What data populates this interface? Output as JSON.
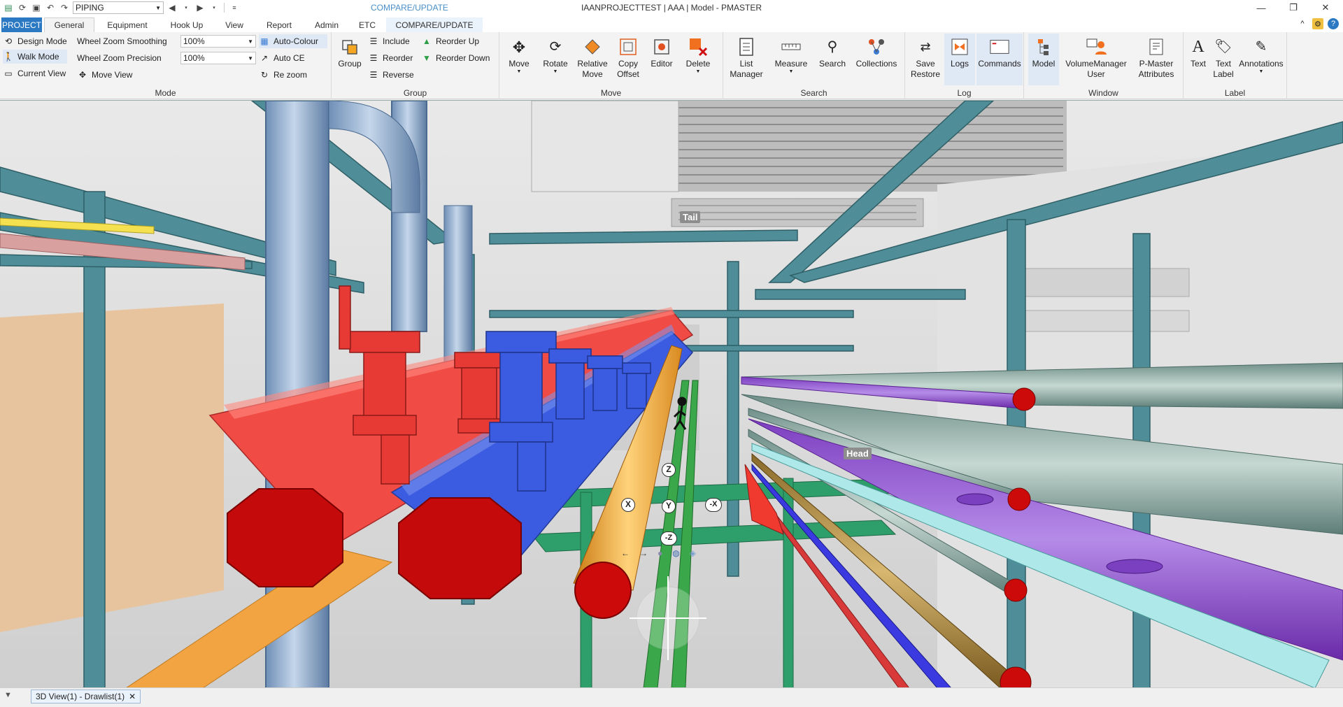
{
  "titlebar": {
    "combo_value": "PIPING",
    "context_tab": "COMPARE/UPDATE",
    "title": "IAANPROJECTTEST | AAA | Model - PMASTER"
  },
  "tabs": {
    "project": "PROJECT",
    "general": "General",
    "equipment": "Equipment",
    "hookup": "Hook Up",
    "view": "View",
    "report": "Report",
    "admin": "Admin",
    "etc": "ETC",
    "compare": "COMPARE/UPDATE"
  },
  "ribbon": {
    "mode": {
      "label": "Mode",
      "design_mode": "Design Mode",
      "walk_mode": "Walk Mode",
      "current_view": "Current View",
      "wheel_smoothing": "Wheel Zoom Smoothing",
      "wheel_precision": "Wheel Zoom Precision",
      "move_view": "Move View",
      "smoothing_value": "100%",
      "precision_value": "100%",
      "auto_colour": "Auto-Colour",
      "auto_ce": "Auto CE",
      "re_zoom": "Re zoom"
    },
    "group": {
      "label": "Group",
      "group_btn": "Group",
      "include": "Include",
      "reorder": "Reorder",
      "reverse": "Reverse",
      "reorder_up": "Reorder Up",
      "reorder_down": "Reorder Down"
    },
    "move": {
      "label": "Move",
      "move": "Move",
      "rotate": "Rotate",
      "relative_move": "Relative Move",
      "copy_offset": "Copy Offset",
      "editor": "Editor",
      "delete": "Delete"
    },
    "search": {
      "label": "Search",
      "list_manager": "List Manager",
      "measure": "Measure",
      "search": "Search",
      "collections": "Collections"
    },
    "log": {
      "label": "Log",
      "save_restore": "Save Restore",
      "logs": "Logs",
      "commands": "Commands"
    },
    "window": {
      "label": "Window",
      "model": "Model",
      "volume_manager": "VolumeManager User",
      "pmaster_attr": "P-Master Attributes"
    },
    "labelgrp": {
      "label": "Label",
      "text": "Text",
      "text_label": "Text Label",
      "annotations": "Annotations"
    }
  },
  "viewport": {
    "tail_label": "Tail",
    "head_label": "Head",
    "axes": {
      "z": "Z",
      "neg_z": "-Z",
      "x": "X",
      "neg_x": "-X",
      "y": "Y"
    }
  },
  "bottom": {
    "doc_tab": "3D View(1) - Drawlist(1)",
    "close": "✕"
  },
  "colors": {
    "accent": "#2b79c2",
    "pipe_red": "#e8433d",
    "pipe_blue": "#3b5ce0",
    "pipe_orange": "#f0a030",
    "pipe_purple": "#8a3fd0",
    "steel_teal": "#4f8e98"
  }
}
